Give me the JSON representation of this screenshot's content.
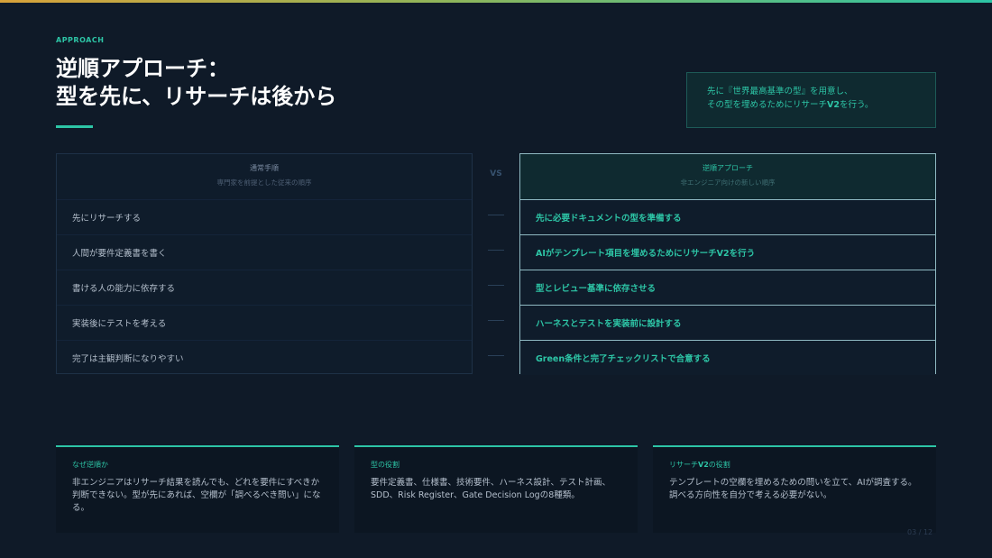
{
  "eyebrow": "APPROACH",
  "title": {
    "line1": "逆順アプローチ：",
    "line2": "型を先に、リサーチは後から"
  },
  "callout": {
    "line1": "先に『世界最高基準の型』を用意し、",
    "line2_pre": "その型を埋めるためにリサーチ",
    "line2_bold": "V2",
    "line2_post": "を行う。"
  },
  "vs_label": "VS",
  "left_table": {
    "title": "通常手順",
    "subtitle": "専門家を前提とした従来の順序",
    "rows": [
      "先にリサーチする",
      "人間が要件定義書を書く",
      "書ける人の能力に依存する",
      "実装後にテストを考える",
      "完了は主観判断になりやすい"
    ]
  },
  "right_table": {
    "title": "逆順アプローチ",
    "subtitle": "非エンジニア向けの新しい順序",
    "rows": [
      "先に必要ドキュメントの型を準備する",
      "AIがテンプレート項目を埋めるためにリサーチV2を行う",
      "型とレビュー基準に依存させる",
      "ハーネスとテストを実装前に設計する",
      "Green条件と完了チェックリストで合意する"
    ]
  },
  "cards": [
    {
      "title": "なぜ逆順か",
      "body": "非エンジニアはリサーチ結果を読んでも、どれを要件にすべきか判断できない。型が先にあれば、空欄が「調べるべき問い」になる。"
    },
    {
      "title": "型の役割",
      "body": "要件定義書、仕様書、技術要件、ハーネス設計、テスト計画、SDD、Risk Register、Gate Decision Logの8種類。"
    },
    {
      "title_pre": "リサーチ",
      "title_bold": "V2",
      "title_post": "の役割",
      "body": "テンプレートの空欄を埋めるための問いを立て、AIが調査する。調べる方向性を自分で考える必要がない。"
    }
  ],
  "page_number": "03 / 12",
  "colors": {
    "accent": "#2dc5a6",
    "background": "#0f1a28",
    "title": "#ffffff"
  }
}
